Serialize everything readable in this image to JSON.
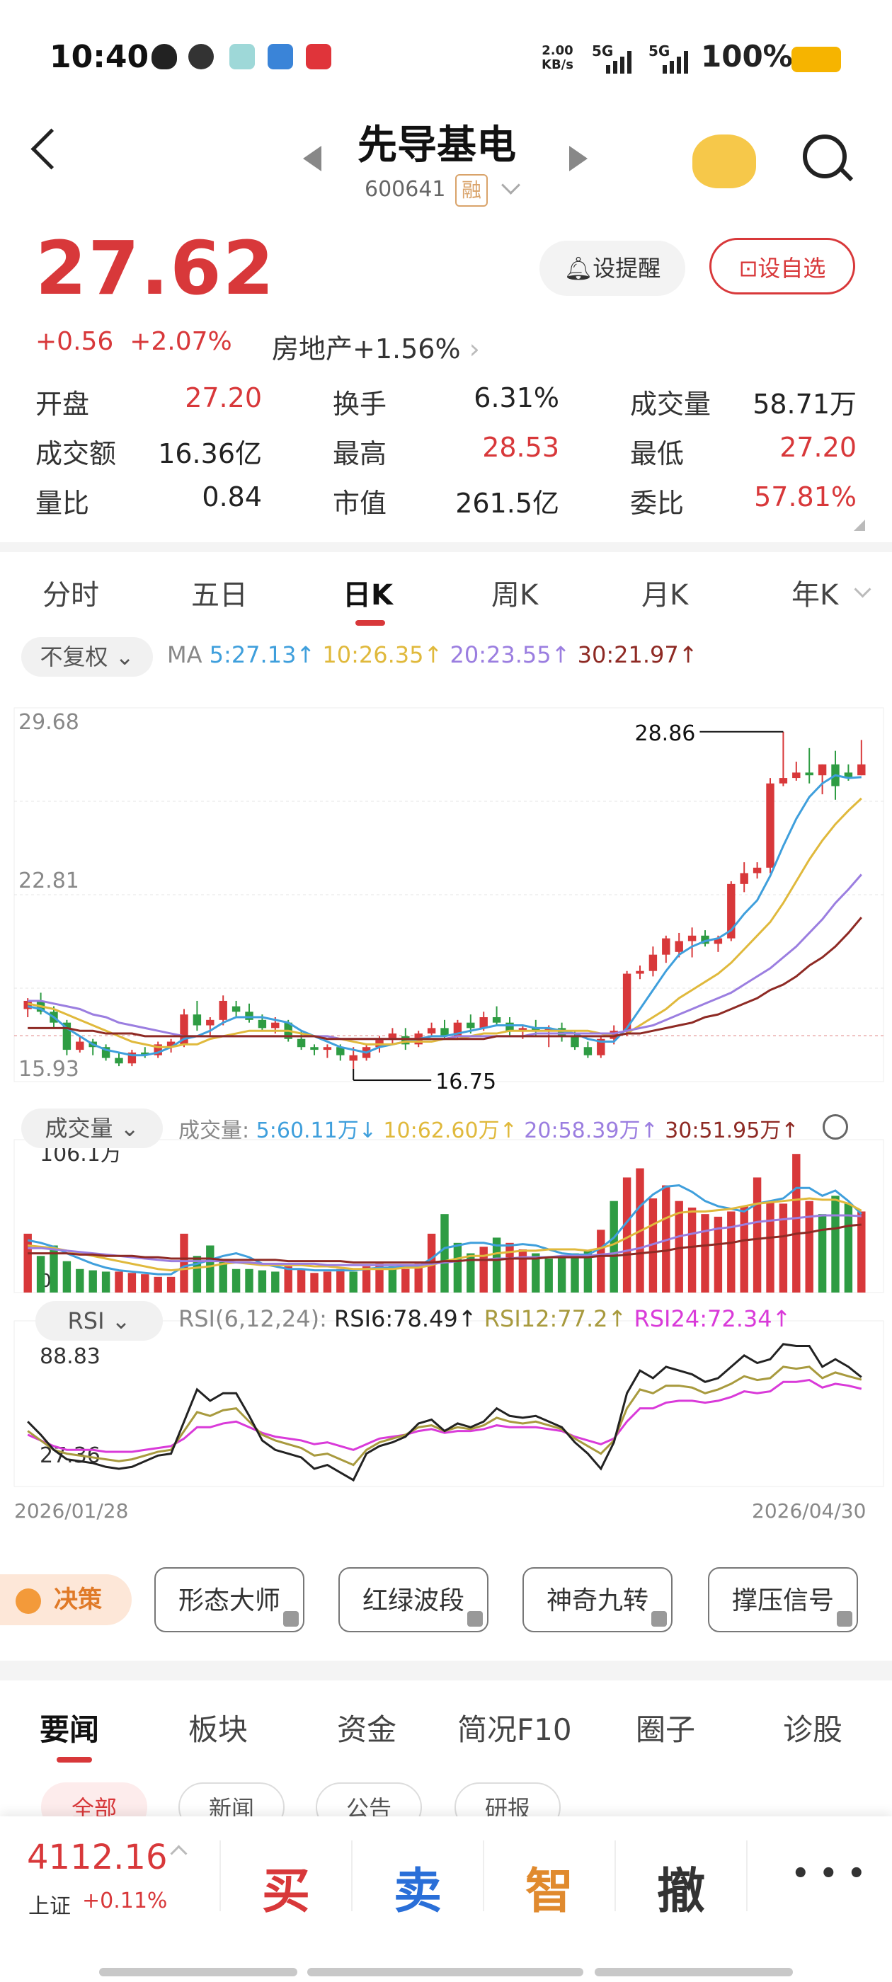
{
  "status_bar": {
    "time": "10:40",
    "net_speed": "2.00\nKB/s",
    "sig1": "5G",
    "sig2": "5G",
    "battery": "100%"
  },
  "header": {
    "name": "先导基电",
    "code": "600641",
    "margin_badge": "融"
  },
  "quote": {
    "price": "27.62",
    "change": "+0.56",
    "change_pct": "+2.07%",
    "sector": "房地产+1.56%",
    "alert_button": "设提醒",
    "watch_button": "设自选"
  },
  "stats": [
    {
      "label": "开盘",
      "value": "27.20",
      "color": "#d8383a"
    },
    {
      "label": "换手",
      "value": "6.31%",
      "color": "#222222"
    },
    {
      "label": "成交量",
      "value": "58.71万",
      "color": "#222222"
    },
    {
      "label": "成交额",
      "value": "16.36亿",
      "color": "#222222"
    },
    {
      "label": "最高",
      "value": "28.53",
      "color": "#d8383a"
    },
    {
      "label": "最低",
      "value": "27.20",
      "color": "#d8383a"
    },
    {
      "label": "量比",
      "value": "0.84",
      "color": "#222222"
    },
    {
      "label": "市值",
      "value": "261.5亿",
      "color": "#222222"
    },
    {
      "label": "委比",
      "value": "57.81%",
      "color": "#d8383a"
    }
  ],
  "period_tabs": [
    "分时",
    "五日",
    "日K",
    "周K",
    "月K",
    "年K"
  ],
  "active_period": "日K",
  "ma_bar": {
    "selector": "不复权",
    "prefix": "MA",
    "ma5": "5:27.13↑",
    "ma10": "10:26.35↑",
    "ma20": "20:23.55↑",
    "ma30": "30:21.97↑"
  },
  "vol_bar": {
    "selector": "成交量",
    "prefix": "成交量:",
    "v5": "5:60.11万↓",
    "v10": "10:62.60万↑",
    "v20": "20:58.39万↑",
    "v30": "30:51.95万↑"
  },
  "rsi_bar": {
    "selector": "RSI",
    "prefix": "RSI(6,12,24):",
    "r6": "RSI6:78.49↑",
    "r12": "RSI12:77.2↑",
    "r24": "RSI24:72.34↑"
  },
  "colors": {
    "up": "#d8383a",
    "down": "#2e9c43",
    "ma5": "#3f9fdc",
    "ma10": "#e0b93c",
    "ma20": "#9b7ee0",
    "ma30": "#8e2a24",
    "rsi6": "#222222",
    "rsi12": "#a89a3e",
    "rsi24": "#d93ad9"
  },
  "chart_data": {
    "type": "candlestick",
    "price_axis": {
      "top": "29.68",
      "mid": "22.81",
      "bottom": "15.93",
      "min": 15.93,
      "max": 29.68
    },
    "high_label": "28.86",
    "low_label": "16.75",
    "volume_axis": {
      "top": "106.1万",
      "bottom": "0",
      "max": 106.1
    },
    "rsi_axis": {
      "top": "88.83",
      "bottom": "27.36",
      "min": 27.36,
      "max": 88.83
    },
    "date_start": "2026/01/28",
    "date_end": "2026/04/30",
    "candles": [
      [
        18.6,
        19.0,
        18.3,
        18.9
      ],
      [
        18.9,
        19.2,
        18.4,
        18.5
      ],
      [
        18.5,
        18.7,
        17.9,
        18.1
      ],
      [
        18.1,
        18.2,
        16.9,
        17.1
      ],
      [
        17.1,
        17.6,
        17.0,
        17.4
      ],
      [
        17.4,
        17.5,
        16.9,
        17.2
      ],
      [
        17.2,
        17.3,
        16.7,
        16.8
      ],
      [
        16.8,
        17.0,
        16.5,
        16.6
      ],
      [
        16.6,
        17.1,
        16.5,
        17.0
      ],
      [
        17.0,
        17.2,
        16.8,
        16.9
      ],
      [
        16.9,
        17.4,
        16.8,
        17.3
      ],
      [
        17.2,
        17.5,
        17.0,
        17.4
      ],
      [
        17.3,
        18.6,
        17.2,
        18.4
      ],
      [
        18.4,
        18.9,
        17.8,
        18.0
      ],
      [
        18.0,
        18.3,
        17.6,
        18.2
      ],
      [
        18.2,
        19.1,
        18.0,
        18.9
      ],
      [
        18.7,
        18.9,
        18.3,
        18.5
      ],
      [
        18.5,
        18.8,
        18.1,
        18.2
      ],
      [
        18.2,
        18.4,
        17.8,
        17.9
      ],
      [
        17.9,
        18.3,
        17.7,
        18.1
      ],
      [
        18.1,
        18.2,
        17.4,
        17.5
      ],
      [
        17.5,
        17.8,
        17.1,
        17.2
      ],
      [
        17.2,
        17.3,
        16.9,
        17.1
      ],
      [
        17.1,
        17.3,
        16.8,
        17.2
      ],
      [
        17.2,
        17.3,
        16.7,
        16.9
      ],
      [
        16.7,
        17.2,
        16.4,
        16.9
      ],
      [
        16.8,
        17.3,
        16.7,
        17.2
      ],
      [
        17.2,
        17.6,
        17.0,
        17.5
      ],
      [
        17.5,
        17.9,
        17.3,
        17.7
      ],
      [
        17.6,
        17.9,
        17.1,
        17.3
      ],
      [
        17.3,
        17.8,
        17.2,
        17.7
      ],
      [
        17.7,
        18.1,
        17.6,
        17.9
      ],
      [
        17.9,
        18.2,
        17.5,
        17.6
      ],
      [
        17.6,
        18.2,
        17.5,
        18.1
      ],
      [
        18.1,
        18.4,
        17.7,
        17.9
      ],
      [
        17.9,
        18.5,
        17.8,
        18.3
      ],
      [
        18.3,
        18.7,
        18.0,
        18.1
      ],
      [
        18.1,
        18.3,
        17.6,
        17.8
      ],
      [
        17.8,
        18.0,
        17.5,
        17.9
      ],
      [
        17.9,
        18.2,
        17.6,
        17.8
      ],
      [
        17.8,
        18.0,
        17.2,
        17.9
      ],
      [
        17.9,
        18.1,
        17.4,
        17.6
      ],
      [
        17.6,
        17.8,
        17.1,
        17.2
      ],
      [
        17.2,
        17.4,
        16.8,
        16.9
      ],
      [
        16.9,
        17.6,
        16.8,
        17.5
      ],
      [
        17.5,
        18.0,
        17.3,
        17.8
      ],
      [
        17.8,
        20.0,
        17.6,
        19.9
      ],
      [
        19.9,
        20.2,
        19.7,
        20.0
      ],
      [
        20.0,
        20.9,
        19.8,
        20.6
      ],
      [
        20.6,
        21.3,
        20.3,
        21.2
      ],
      [
        20.7,
        21.4,
        20.5,
        21.1
      ],
      [
        21.1,
        21.6,
        20.5,
        21.3
      ],
      [
        21.3,
        21.5,
        20.9,
        21.0
      ],
      [
        21.0,
        21.3,
        20.7,
        21.2
      ],
      [
        21.2,
        23.3,
        21.1,
        23.2
      ],
      [
        23.2,
        24.0,
        22.9,
        23.6
      ],
      [
        23.6,
        24.0,
        23.4,
        23.8
      ],
      [
        23.8,
        27.1,
        23.6,
        26.9
      ],
      [
        26.9,
        28.8,
        26.8,
        27.1
      ],
      [
        27.1,
        27.7,
        27.0,
        27.3
      ],
      [
        27.3,
        28.2,
        26.9,
        27.2
      ],
      [
        27.2,
        27.6,
        26.5,
        27.6
      ],
      [
        27.6,
        28.1,
        26.3,
        26.8
      ],
      [
        27.3,
        27.6,
        27.0,
        27.1
      ],
      [
        27.2,
        28.5,
        27.2,
        27.6
      ]
    ],
    "volumes": [
      [
        45,
        1
      ],
      [
        28,
        -1
      ],
      [
        36,
        -1
      ],
      [
        24,
        -1
      ],
      [
        18,
        -1
      ],
      [
        17,
        -1
      ],
      [
        16,
        -1
      ],
      [
        16,
        1
      ],
      [
        15,
        1
      ],
      [
        14,
        1
      ],
      [
        12,
        1
      ],
      [
        12,
        1
      ],
      [
        45,
        1
      ],
      [
        28,
        -1
      ],
      [
        36,
        -1
      ],
      [
        24,
        -1
      ],
      [
        18,
        -1
      ],
      [
        18,
        -1
      ],
      [
        17,
        -1
      ],
      [
        16,
        -1
      ],
      [
        20,
        1
      ],
      [
        18,
        1
      ],
      [
        15,
        1
      ],
      [
        16,
        1
      ],
      [
        18,
        1
      ],
      [
        16,
        -1
      ],
      [
        20,
        1
      ],
      [
        22,
        1
      ],
      [
        20,
        -1
      ],
      [
        18,
        1
      ],
      [
        22,
        1
      ],
      [
        45,
        1
      ],
      [
        60,
        -1
      ],
      [
        38,
        -1
      ],
      [
        30,
        -1
      ],
      [
        35,
        1
      ],
      [
        42,
        -1
      ],
      [
        38,
        1
      ],
      [
        33,
        1
      ],
      [
        30,
        -1
      ],
      [
        26,
        -1
      ],
      [
        28,
        -1
      ],
      [
        30,
        -1
      ],
      [
        32,
        -1
      ],
      [
        48,
        1
      ],
      [
        70,
        -1
      ],
      [
        88,
        1
      ],
      [
        95,
        1
      ],
      [
        72,
        1
      ],
      [
        82,
        1
      ],
      [
        70,
        1
      ],
      [
        65,
        1
      ],
      [
        60,
        1
      ],
      [
        58,
        1
      ],
      [
        62,
        1
      ],
      [
        66,
        1
      ],
      [
        88,
        1
      ],
      [
        70,
        1
      ],
      [
        68,
        1
      ],
      [
        106,
        1
      ],
      [
        70,
        1
      ],
      [
        60,
        -1
      ],
      [
        74,
        -1
      ],
      [
        68,
        -1
      ],
      [
        62,
        1
      ]
    ],
    "ma_series": {
      "ma5": [
        18.7,
        18.6,
        18.3,
        17.9,
        17.6,
        17.3,
        17.1,
        17.0,
        16.9,
        16.9,
        17.0,
        17.2,
        17.5,
        17.6,
        17.8,
        18.1,
        18.3,
        18.3,
        18.3,
        18.2,
        18.1,
        17.8,
        17.6,
        17.4,
        17.2,
        17.1,
        17.0,
        17.2,
        17.3,
        17.4,
        17.5,
        17.6,
        17.6,
        17.7,
        17.8,
        17.9,
        18.0,
        18.0,
        18.0,
        17.9,
        17.9,
        17.8,
        17.7,
        17.5,
        17.4,
        17.4,
        17.9,
        18.6,
        19.3,
        20.0,
        20.6,
        20.9,
        21.1,
        21.2,
        21.5,
        22.1,
        22.6,
        23.5,
        24.6,
        25.6,
        26.4,
        26.9,
        27.2,
        27.1,
        27.13
      ],
      "ma10": [
        18.8,
        18.7,
        18.6,
        18.4,
        18.2,
        18.0,
        17.8,
        17.6,
        17.4,
        17.3,
        17.2,
        17.2,
        17.3,
        17.3,
        17.5,
        17.6,
        17.7,
        17.8,
        17.8,
        17.8,
        17.8,
        17.7,
        17.6,
        17.6,
        17.5,
        17.4,
        17.3,
        17.3,
        17.3,
        17.4,
        17.4,
        17.4,
        17.5,
        17.5,
        17.6,
        17.7,
        17.7,
        17.8,
        17.8,
        17.8,
        17.8,
        17.8,
        17.8,
        17.8,
        17.7,
        17.6,
        17.7,
        18.0,
        18.3,
        18.6,
        19.0,
        19.3,
        19.6,
        19.9,
        20.3,
        20.8,
        21.3,
        21.8,
        22.5,
        23.3,
        24.1,
        24.8,
        25.4,
        25.9,
        26.35
      ],
      "ma20": [
        18.9,
        18.9,
        18.8,
        18.7,
        18.6,
        18.4,
        18.3,
        18.1,
        18.0,
        17.9,
        17.8,
        17.7,
        17.6,
        17.6,
        17.6,
        17.6,
        17.6,
        17.6,
        17.6,
        17.6,
        17.6,
        17.6,
        17.6,
        17.6,
        17.5,
        17.5,
        17.5,
        17.5,
        17.5,
        17.5,
        17.5,
        17.5,
        17.5,
        17.6,
        17.6,
        17.6,
        17.6,
        17.6,
        17.6,
        17.7,
        17.7,
        17.7,
        17.7,
        17.7,
        17.7,
        17.7,
        17.8,
        17.9,
        18.0,
        18.2,
        18.4,
        18.6,
        18.8,
        19.0,
        19.2,
        19.5,
        19.8,
        20.1,
        20.5,
        20.9,
        21.4,
        21.9,
        22.5,
        23.0,
        23.55
      ],
      "ma30": [
        17.9,
        17.9,
        17.9,
        17.9,
        17.8,
        17.8,
        17.7,
        17.7,
        17.7,
        17.6,
        17.6,
        17.6,
        17.6,
        17.6,
        17.6,
        17.6,
        17.6,
        17.6,
        17.6,
        17.6,
        17.6,
        17.6,
        17.6,
        17.5,
        17.5,
        17.5,
        17.5,
        17.5,
        17.5,
        17.5,
        17.5,
        17.5,
        17.5,
        17.5,
        17.5,
        17.5,
        17.6,
        17.6,
        17.6,
        17.6,
        17.6,
        17.6,
        17.6,
        17.6,
        17.6,
        17.6,
        17.7,
        17.7,
        17.8,
        17.9,
        18.0,
        18.1,
        18.3,
        18.4,
        18.6,
        18.8,
        19.0,
        19.3,
        19.5,
        19.8,
        20.2,
        20.5,
        20.9,
        21.4,
        21.97
      ]
    },
    "vol_ma": {
      "ma5": [
        40,
        38,
        35,
        30,
        26,
        22,
        19,
        17,
        16,
        15,
        14,
        14,
        20,
        22,
        25,
        28,
        30,
        27,
        22,
        20,
        18,
        18,
        17,
        17,
        17,
        17,
        18,
        19,
        19,
        20,
        20,
        26,
        34,
        36,
        38,
        38,
        36,
        36,
        37,
        36,
        33,
        30,
        29,
        29,
        34,
        42,
        54,
        66,
        75,
        81,
        82,
        77,
        70,
        66,
        64,
        62,
        68,
        70,
        72,
        80,
        80,
        74,
        78,
        70,
        60
      ],
      "ma10": [
        36,
        35,
        34,
        32,
        30,
        28,
        26,
        24,
        22,
        20,
        18,
        17,
        18,
        19,
        20,
        22,
        23,
        22,
        21,
        21,
        21,
        21,
        20,
        20,
        19,
        18,
        18,
        18,
        18,
        19,
        19,
        21,
        24,
        26,
        28,
        28,
        30,
        31,
        32,
        32,
        33,
        33,
        33,
        32,
        34,
        37,
        42,
        47,
        52,
        57,
        61,
        62,
        62,
        63,
        64,
        66,
        68,
        69,
        70,
        71,
        72,
        71,
        71,
        68,
        62.6
      ],
      "ma20": [
        34,
        34,
        33,
        32,
        31,
        30,
        29,
        28,
        27,
        26,
        25,
        24,
        24,
        24,
        24,
        24,
        23,
        23,
        22,
        22,
        22,
        22,
        22,
        21,
        21,
        21,
        21,
        21,
        21,
        21,
        21,
        22,
        23,
        24,
        25,
        25,
        26,
        26,
        27,
        27,
        27,
        28,
        28,
        28,
        29,
        30,
        32,
        34,
        37,
        40,
        43,
        45,
        47,
        49,
        50,
        52,
        54,
        55,
        56,
        57,
        58,
        59,
        59,
        59,
        58.4
      ],
      "ma30": [
        30,
        30,
        30,
        30,
        29,
        29,
        28,
        28,
        28,
        27,
        27,
        26,
        26,
        26,
        26,
        25,
        25,
        25,
        25,
        25,
        24,
        24,
        24,
        24,
        24,
        23,
        23,
        23,
        23,
        23,
        23,
        23,
        24,
        24,
        25,
        25,
        25,
        26,
        26,
        26,
        27,
        27,
        27,
        27,
        28,
        28,
        29,
        30,
        31,
        32,
        34,
        35,
        36,
        37,
        38,
        40,
        41,
        42,
        43,
        45,
        46,
        48,
        49,
        51,
        51.95
      ]
    },
    "rsi": {
      "rsi6": [
        55,
        48,
        40,
        35,
        34,
        33,
        31,
        30,
        31,
        34,
        37,
        38,
        55,
        72,
        66,
        70,
        70,
        58,
        45,
        40,
        38,
        36,
        30,
        32,
        28,
        24,
        38,
        42,
        44,
        47,
        54,
        56,
        50,
        54,
        52,
        55,
        62,
        58,
        57,
        58,
        55,
        52,
        44,
        38,
        30,
        44,
        70,
        82,
        78,
        84,
        82,
        80,
        76,
        78,
        84,
        90,
        86,
        88,
        96,
        95,
        95,
        84,
        88,
        84,
        78.5
      ],
      "rsi12": [
        50,
        45,
        40,
        38,
        37,
        36,
        35,
        34,
        35,
        37,
        39,
        40,
        50,
        60,
        58,
        61,
        62,
        55,
        48,
        45,
        43,
        41,
        37,
        38,
        35,
        32,
        40,
        44,
        46,
        48,
        52,
        53,
        50,
        52,
        51,
        53,
        57,
        55,
        54,
        55,
        53,
        51,
        46,
        42,
        38,
        45,
        62,
        72,
        70,
        74,
        74,
        73,
        70,
        72,
        75,
        79,
        77,
        78,
        84,
        83,
        84,
        78,
        81,
        79,
        77.2
      ],
      "rsi24": [
        48,
        45,
        42,
        40,
        40,
        40,
        39,
        39,
        39,
        40,
        41,
        42,
        46,
        52,
        52,
        54,
        55,
        52,
        49,
        47,
        46,
        45,
        43,
        44,
        42,
        40,
        43,
        46,
        47,
        48,
        50,
        51,
        49,
        50,
        50,
        51,
        53,
        52,
        52,
        52,
        51,
        50,
        47,
        45,
        43,
        46,
        55,
        62,
        62,
        65,
        66,
        66,
        65,
        66,
        68,
        71,
        70,
        71,
        76,
        76,
        77,
        73,
        75,
        74,
        72.34
      ]
    }
  },
  "tool_chips": {
    "decision": "决策",
    "chips": [
      "形态大师",
      "红绿波段",
      "神奇九转",
      "撑压信号"
    ]
  },
  "news_tabs": [
    "要闻",
    "板块",
    "资金",
    "简况F10",
    "圈子",
    "诊股"
  ],
  "news_pills": [
    "全部",
    "新闻",
    "公告",
    "研报"
  ],
  "bottom": {
    "index_value": "4112.16",
    "index_name": "上证",
    "index_change": "+0.11%",
    "buy": "买",
    "sell": "卖",
    "smart": "智",
    "cancel": "撤",
    "more": "• • •"
  }
}
